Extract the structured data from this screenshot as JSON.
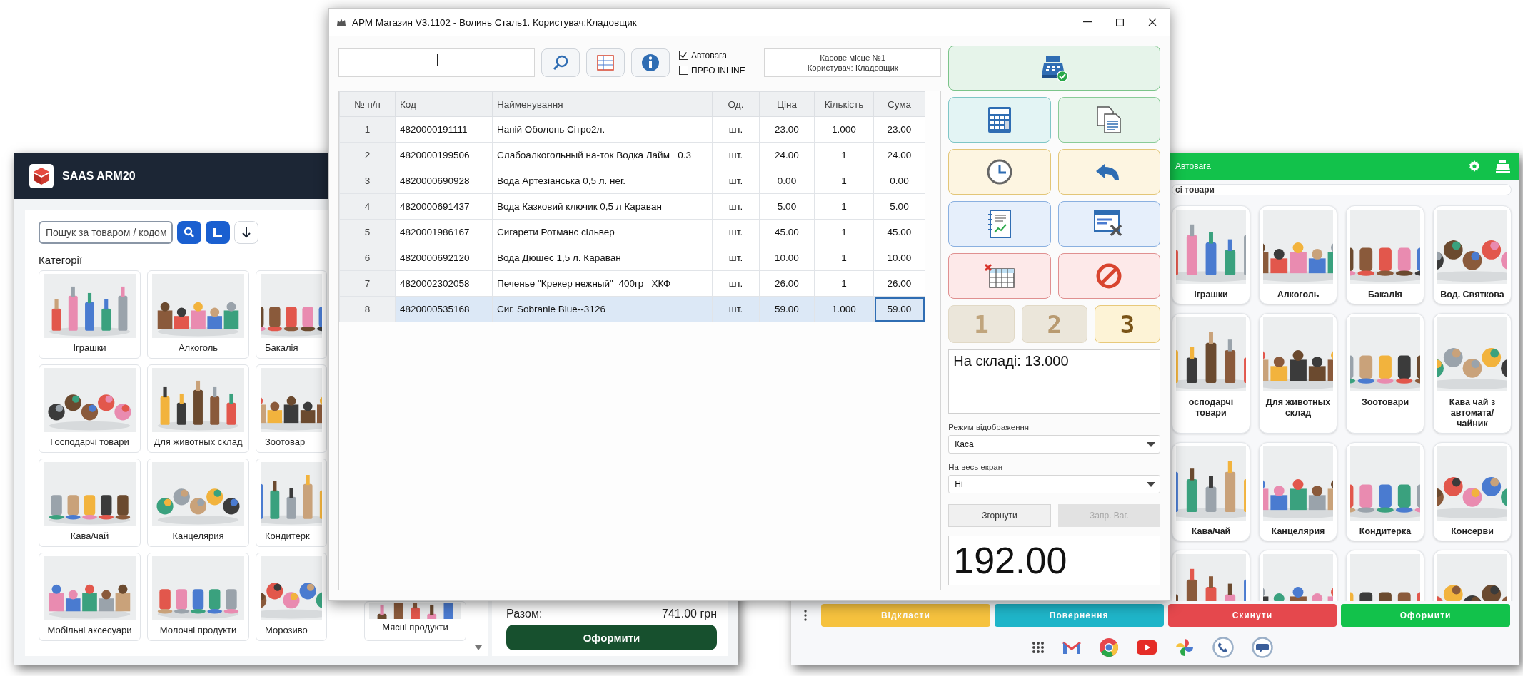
{
  "left_window": {
    "title": "SAAS ARM20",
    "search": {
      "placeholder": "Пошук за товаром / кодом"
    },
    "categories_heading": "Категорії",
    "categories": [
      {
        "label": "Іграшки"
      },
      {
        "label": "Алкоголь"
      },
      {
        "label": "Бакалія"
      },
      {
        "label": "Господарчі товари"
      },
      {
        "label": "Для животных склад"
      },
      {
        "label": "Зоотовар"
      },
      {
        "label": "Кава/чай"
      },
      {
        "label": "Канцелярия"
      },
      {
        "label": "Кондитерк"
      },
      {
        "label": "Мобільні аксесуари"
      },
      {
        "label": "Молочні продукти"
      },
      {
        "label": "Морозиво"
      },
      {
        "label": "Мясні продукти"
      }
    ],
    "total_label": "Разом:",
    "total_value": "741.00 грн",
    "checkout_button": "Оформити"
  },
  "main_window": {
    "title": "АРМ Магазин V3.1102 - Волинь Сталь1. Користувач:Кладовщик",
    "checkboxes": [
      {
        "label": "Автовага",
        "checked": true
      },
      {
        "label": "ПРРО INLINE",
        "checked": false
      }
    ],
    "info_lines": [
      "Касове місце №1",
      "Користувач: Кладовщик"
    ],
    "table": {
      "columns": [
        "№ п/п",
        "Код",
        "Найменування",
        "Од.",
        "Ціна",
        "Кількість",
        "Сума"
      ],
      "rows": [
        {
          "cells": [
            "1",
            "4820000191111",
            "Напій Оболонь Сітро2л.",
            "шт.",
            "23.00",
            "1.000",
            "23.00"
          ],
          "selected": false
        },
        {
          "cells": [
            "2",
            "4820000199506",
            "Слабоалкогольный на-ток Водка Лайм   0.3",
            "шт.",
            "24.00",
            "1",
            "24.00"
          ],
          "selected": false
        },
        {
          "cells": [
            "3",
            "4820000690928",
            "Вода Артезіанська 0,5 л. нег.",
            "шт.",
            "0.00",
            "1",
            "0.00"
          ],
          "selected": false
        },
        {
          "cells": [
            "4",
            "4820000691437",
            "Вода Казковий ключик 0,5 л Караван",
            "шт.",
            "5.00",
            "1",
            "5.00"
          ],
          "selected": false
        },
        {
          "cells": [
            "5",
            "4820001986167",
            "Сигарети Ротманс сільвер",
            "шт.",
            "45.00",
            "1",
            "45.00"
          ],
          "selected": false
        },
        {
          "cells": [
            "6",
            "4820000692120",
            "Вода Дюшес 1,5 л. Караван",
            "шт.",
            "10.00",
            "1",
            "10.00"
          ],
          "selected": false
        },
        {
          "cells": [
            "7",
            "4820002302058",
            "Печенье \"Крекер нежный\"  400гр   ХКФ",
            "шт.",
            "26.00",
            "1",
            "26.00"
          ],
          "selected": false
        },
        {
          "cells": [
            "8",
            "4820000535168",
            "Сиг. Sobranie Blue--3126",
            "шт.",
            "59.00",
            "1.000",
            "59.00"
          ],
          "selected": true
        }
      ]
    },
    "number_buttons": [
      {
        "label": "1",
        "selected": false
      },
      {
        "label": "2",
        "selected": false
      },
      {
        "label": "3",
        "selected": true
      }
    ],
    "stock_text": "На складі: 13.000",
    "selects": [
      {
        "label": "Режим відображення",
        "value": "Каса"
      },
      {
        "label": "На весь екран",
        "value": "Ні"
      }
    ],
    "buttons": [
      {
        "label": "Згорнути",
        "disabled": false
      },
      {
        "label": "Запр. Ваг.",
        "disabled": true
      }
    ],
    "total": "192.00"
  },
  "right_window": {
    "header_label": "Автовага",
    "search_text": "сі товари",
    "categories": [
      {
        "kind": "category",
        "label": "Іграшки"
      },
      {
        "kind": "category",
        "label": "Алкоголь"
      },
      {
        "kind": "category",
        "label": "Бакалія"
      },
      {
        "kind": "category",
        "label": "Вод. Святкова"
      },
      {
        "kind": "category",
        "label": "осподарчі товари"
      },
      {
        "kind": "category",
        "label": "Для животных склад"
      },
      {
        "kind": "category",
        "label": "Зоотовари"
      },
      {
        "kind": "category",
        "label": "Кава чай з автомата/чайник"
      },
      {
        "kind": "category",
        "label": "Кава/чай"
      },
      {
        "kind": "category",
        "label": "Канцелярия"
      },
      {
        "kind": "category",
        "label": "Кондитерка"
      },
      {
        "kind": "category",
        "label": "Консерви"
      },
      {
        "kind": "picture"
      },
      {
        "kind": "picture"
      },
      {
        "kind": "picture"
      },
      {
        "kind": "picture"
      }
    ],
    "actions": [
      {
        "label": "Відкласти",
        "color": "#f6c23e"
      },
      {
        "label": "Повернення",
        "color": "#1fb5c9"
      },
      {
        "label": "Скинути",
        "color": "#e5484d"
      },
      {
        "label": "Оформити",
        "color": "#12c24b"
      }
    ]
  }
}
